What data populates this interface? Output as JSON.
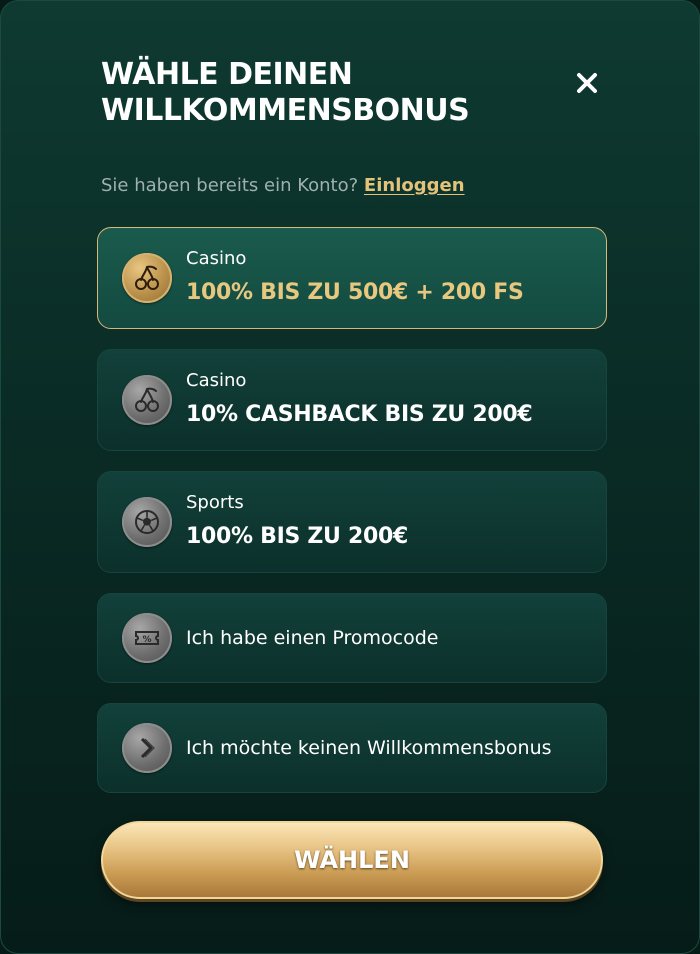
{
  "header": {
    "title_line1": "WÄHLE DEINEN",
    "title_line2": "WILLKOMMENSBONUS",
    "close_icon": "close-icon"
  },
  "login": {
    "prompt": "Sie haben bereits ein Konto?",
    "link_label": "Einloggen"
  },
  "options": [
    {
      "category": "Casino",
      "title": "100% BIS ZU 500€ + 200 FS",
      "icon": "cherry-icon",
      "selected": true
    },
    {
      "category": "Casino",
      "title": "10% CASHBACK BIS ZU 200€",
      "icon": "cherry-icon",
      "selected": false
    },
    {
      "category": "Sports",
      "title": "100% BIS ZU 200€",
      "icon": "soccer-ball-icon",
      "selected": false
    },
    {
      "label": "Ich habe einen Promocode",
      "icon": "ticket-icon",
      "selected": false
    },
    {
      "label": "Ich möchte keinen Willkommensbonus",
      "icon": "chevron-right-icon",
      "selected": false
    }
  ],
  "actions": {
    "choose_label": "WÄHLEN"
  },
  "colors": {
    "accent_gold": "#e3c27a",
    "background": "#0a2b25"
  }
}
